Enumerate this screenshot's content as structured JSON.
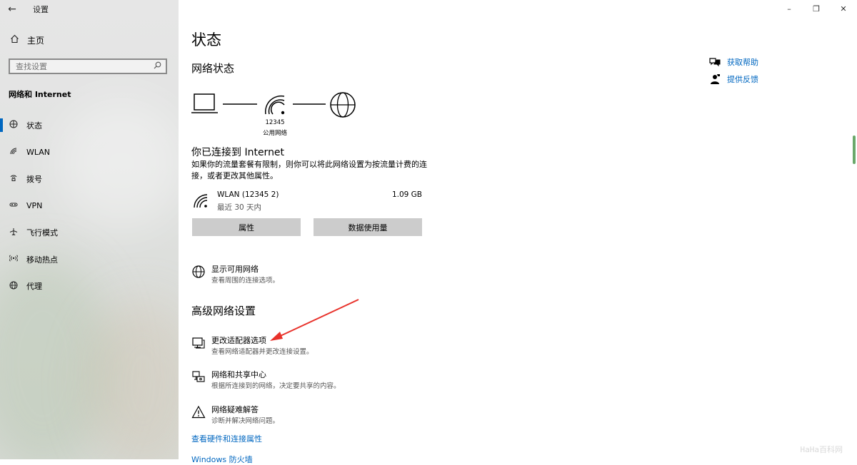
{
  "window": {
    "title": "设置",
    "back": "←",
    "minimize": "–",
    "restore": "❐",
    "close": "✕"
  },
  "sidebar": {
    "home_label": "主页",
    "search_placeholder": "查找设置",
    "section_title": "网络和 Internet",
    "items": [
      {
        "label": "状态",
        "icon": "status-icon",
        "active": true
      },
      {
        "label": "WLAN",
        "icon": "wlan-icon",
        "active": false
      },
      {
        "label": "拨号",
        "icon": "dialup-icon",
        "active": false
      },
      {
        "label": "VPN",
        "icon": "vpn-icon",
        "active": false
      },
      {
        "label": "飞行模式",
        "icon": "airplane-icon",
        "active": false
      },
      {
        "label": "移动热点",
        "icon": "hotspot-icon",
        "active": false
      },
      {
        "label": "代理",
        "icon": "proxy-icon",
        "active": false
      }
    ]
  },
  "main": {
    "title": "状态",
    "network_status_heading": "网络状态",
    "diagram": {
      "ssid": "12345",
      "network_type": "公用网络"
    },
    "connected_title": "你已连接到 Internet",
    "connected_desc": "如果你的流量套餐有限制，则你可以将此网络设置为按流量计费的连接，或者更改其他属性。",
    "connection": {
      "name": "WLAN (12345 2)",
      "period": "最近 30 天内",
      "usage": "1.09 GB"
    },
    "buttons": {
      "properties": "属性",
      "data_usage": "数据使用量"
    },
    "show_networks": {
      "title": "显示可用网络",
      "desc": "查看周围的连接选项。"
    },
    "advanced_heading": "高级网络设置",
    "advanced": [
      {
        "title": "更改适配器选项",
        "desc": "查看网络适配器并更改连接设置。",
        "icon": "adapter-icon"
      },
      {
        "title": "网络和共享中心",
        "desc": "根据所连接到的网络，决定要共享的内容。",
        "icon": "sharing-center-icon"
      },
      {
        "title": "网络疑难解答",
        "desc": "诊断并解决网络问题。",
        "icon": "warning-icon"
      }
    ],
    "links": {
      "hardware_props": "查看硬件和连接属性",
      "firewall": "Windows 防火墙"
    }
  },
  "help": {
    "get_help": "获取帮助",
    "feedback": "提供反馈"
  },
  "accent_color": "#0067c0",
  "annotation_color": "#e8312a",
  "watermark": "HaHa百科网"
}
